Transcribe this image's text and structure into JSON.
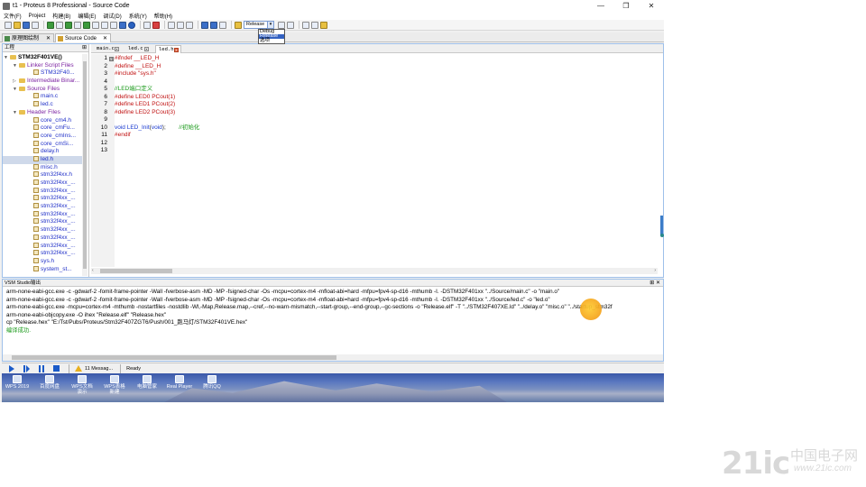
{
  "window": {
    "title": "t1 - Proteus 8 Professional - Source Code",
    "controls": [
      "—",
      "❐",
      "✕"
    ]
  },
  "menu": [
    "文件(F)",
    "Project",
    "构建(B)",
    "编辑(E)",
    "调试(D)",
    "系统(Y)",
    "帮助(H)"
  ],
  "toolbar": {
    "build_config": "Release",
    "dropdown_options": [
      "Debug",
      "Release",
      "选项"
    ],
    "dropdown_selected_index": 1
  },
  "doc_tabs": [
    {
      "label": "原理图绘制",
      "close": "✕"
    },
    {
      "label": "Source Code",
      "close": "✕"
    }
  ],
  "project_panel": {
    "title": "工程",
    "pin": "⊞",
    "tree": [
      {
        "label": "STM32F401VE()",
        "level": 0,
        "kind": "root",
        "twisty": "▼"
      },
      {
        "label": "Linker Script Files",
        "level": 1,
        "kind": "folder",
        "twisty": "▼"
      },
      {
        "label": "STM32F40...",
        "level": 2,
        "kind": "file"
      },
      {
        "label": "Intermediate Binar...",
        "level": 1,
        "kind": "folder",
        "twisty": "▷"
      },
      {
        "label": "Source Files",
        "level": 1,
        "kind": "folder",
        "twisty": "▼"
      },
      {
        "label": "main.c",
        "level": 2,
        "kind": "file"
      },
      {
        "label": "led.c",
        "level": 2,
        "kind": "file"
      },
      {
        "label": "Header Files",
        "level": 1,
        "kind": "folder",
        "twisty": "▼"
      },
      {
        "label": "core_cm4.h",
        "level": 2,
        "kind": "file"
      },
      {
        "label": "core_cmFu...",
        "level": 2,
        "kind": "file"
      },
      {
        "label": "core_cmIns...",
        "level": 2,
        "kind": "file"
      },
      {
        "label": "core_cmSi...",
        "level": 2,
        "kind": "file"
      },
      {
        "label": "delay.h",
        "level": 2,
        "kind": "file"
      },
      {
        "label": "led.h",
        "level": 2,
        "kind": "file",
        "selected": true
      },
      {
        "label": "misc.h",
        "level": 2,
        "kind": "file"
      },
      {
        "label": "stm32f4xx.h",
        "level": 2,
        "kind": "file"
      },
      {
        "label": "stm32f4xx_...",
        "level": 2,
        "kind": "file"
      },
      {
        "label": "stm32f4xx_...",
        "level": 2,
        "kind": "file"
      },
      {
        "label": "stm32f4xx_...",
        "level": 2,
        "kind": "file"
      },
      {
        "label": "stm32f4xx_...",
        "level": 2,
        "kind": "file"
      },
      {
        "label": "stm32f4xx_...",
        "level": 2,
        "kind": "file"
      },
      {
        "label": "stm32f4xx_...",
        "level": 2,
        "kind": "file"
      },
      {
        "label": "stm32f4xx_...",
        "level": 2,
        "kind": "file"
      },
      {
        "label": "stm32f4xx_...",
        "level": 2,
        "kind": "file"
      },
      {
        "label": "stm32f4xx_...",
        "level": 2,
        "kind": "file"
      },
      {
        "label": "stm32f4xx_...",
        "level": 2,
        "kind": "file"
      },
      {
        "label": "sys.h",
        "level": 2,
        "kind": "file"
      },
      {
        "label": "system_st...",
        "level": 2,
        "kind": "file"
      }
    ]
  },
  "editor": {
    "tabs": [
      {
        "label": "main.c",
        "close": "×"
      },
      {
        "label": "led.c",
        "close": "×"
      },
      {
        "label": "led.h",
        "close": "×",
        "active": true
      }
    ],
    "lines": [
      {
        "num": "1",
        "fold": "⊟",
        "segs": [
          {
            "t": "#ifndef __LED_H",
            "c": "kw"
          }
        ]
      },
      {
        "num": "2",
        "segs": [
          {
            "t": "#define __LED_H",
            "c": "kw"
          }
        ]
      },
      {
        "num": "3",
        "segs": [
          {
            "t": "#include \"sys.h\"",
            "c": "kw"
          }
        ]
      },
      {
        "num": "4",
        "segs": []
      },
      {
        "num": "5",
        "segs": [
          {
            "t": "//LED端口定义",
            "c": "cm"
          }
        ]
      },
      {
        "num": "6",
        "segs": [
          {
            "t": "#define LED0 PCout(1)",
            "c": "kw"
          }
        ]
      },
      {
        "num": "7",
        "segs": [
          {
            "t": "#define LED1 PCout(2)",
            "c": "kw"
          }
        ]
      },
      {
        "num": "8",
        "segs": [
          {
            "t": "#define LED2 PCout(3)",
            "c": "kw"
          }
        ]
      },
      {
        "num": "9",
        "segs": []
      },
      {
        "num": "10",
        "segs": [
          {
            "t": "void ",
            "c": "fn"
          },
          {
            "t": "LED_Init",
            "c": "fn"
          },
          {
            "t": "(",
            "c": "pl"
          },
          {
            "t": "void",
            "c": "fn"
          },
          {
            "t": ");        ",
            "c": "pl"
          },
          {
            "t": "//初始化",
            "c": "cm"
          }
        ]
      },
      {
        "num": "11",
        "segs": [
          {
            "t": "#endif",
            "c": "kw"
          }
        ]
      },
      {
        "num": "12",
        "segs": []
      },
      {
        "num": "13",
        "segs": []
      }
    ]
  },
  "output": {
    "title": "VSM Studio输出",
    "controls": "⊞ ✕",
    "lines": [
      {
        "text": "arm-none-eabi-gcc.exe -c -gdwarf-2 -fomit-frame-pointer -Wall -fverbose-asm -MD -MP -fsigned-char -Os -mcpu=cortex-m4 -mfloat-abi=hard -mfpu=fpv4-sp-d16 -mthumb -I. -DSTM32F401xx   \"../Source/main.c\" -o \"main.o\"",
        "ok": false
      },
      {
        "text": "arm-none-eabi-gcc.exe -c -gdwarf-2 -fomit-frame-pointer -Wall -fverbose-asm -MD -MP -fsigned-char -Os -mcpu=cortex-m4 -mfloat-abi=hard -mfpu=fpv4-sp-d16 -mthumb -I. -DSTM32F401xx   \"../Source/led.c\" -o \"led.o\"",
        "ok": false
      },
      {
        "text": "arm-none-eabi-gcc.exe -mcpu=cortex-m4 -mthumb -nostartfiles -nostdlib  -Wl,-Map,Release.map,--cref,--no-warn-mismatch,--start-group,--end-group,--gc-sections -o \"Release.elf\"  -T \"../STM32F407XE.ld\" \"../delay.o\" \"misc.o\" \"../startup_stm32f",
        "ok": false
      },
      {
        "text": "arm-none-eabi-objcopy.exe -O ihex  \"Release.elf\" \"Release.hex\"",
        "ok": false
      },
      {
        "text": "cp \"Release.hex\" \"E:/Tst/Pubs/Proteus/Stm32F407ZGT6/Push/001_跑马灯/STM32F401VE.hex\"",
        "ok": false
      },
      {
        "text": "编译成功.",
        "ok": true
      }
    ]
  },
  "status": {
    "messages": "11 Messag...",
    "ready": "Ready"
  },
  "desktop_icons": [
    "WPS 2019",
    "百度网盘",
    "WPS文档 演示",
    "WPS表格 新建",
    "电脑管家",
    "Real Player",
    "腾讯QQ"
  ],
  "watermark": {
    "main": "21ic",
    "cn": "中国电子网",
    "url": "www.21ic.com"
  }
}
